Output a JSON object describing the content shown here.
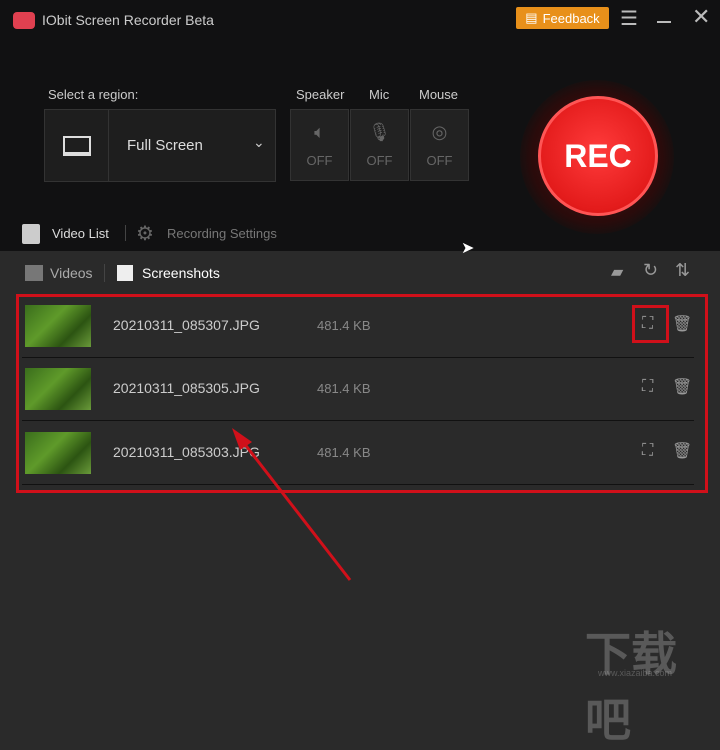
{
  "app": {
    "title": "IObit Screen Recorder Beta",
    "feedback_label": "Feedback"
  },
  "region": {
    "label": "Select a region:",
    "value": "Full Screen"
  },
  "toggles": [
    {
      "label": "Speaker",
      "state": "OFF"
    },
    {
      "label": "Mic",
      "state": "OFF"
    },
    {
      "label": "Mouse",
      "state": "OFF"
    }
  ],
  "rec_label": "REC",
  "nav": {
    "video_list": "Video List",
    "recording_settings": "Recording Settings"
  },
  "subtabs": {
    "videos": "Videos",
    "screenshots": "Screenshots"
  },
  "files": [
    {
      "name": "20210311_085307.JPG",
      "size": "481.4 KB"
    },
    {
      "name": "20210311_085305.JPG",
      "size": "481.4 KB"
    },
    {
      "name": "20210311_085303.JPG",
      "size": "481.4 KB"
    }
  ],
  "watermark": {
    "text": "下载吧",
    "url": "www.xiazaiba.com"
  },
  "colors": {
    "accent": "#e31b1b",
    "feedback": "#e8901a",
    "annotation": "#d0101a"
  }
}
